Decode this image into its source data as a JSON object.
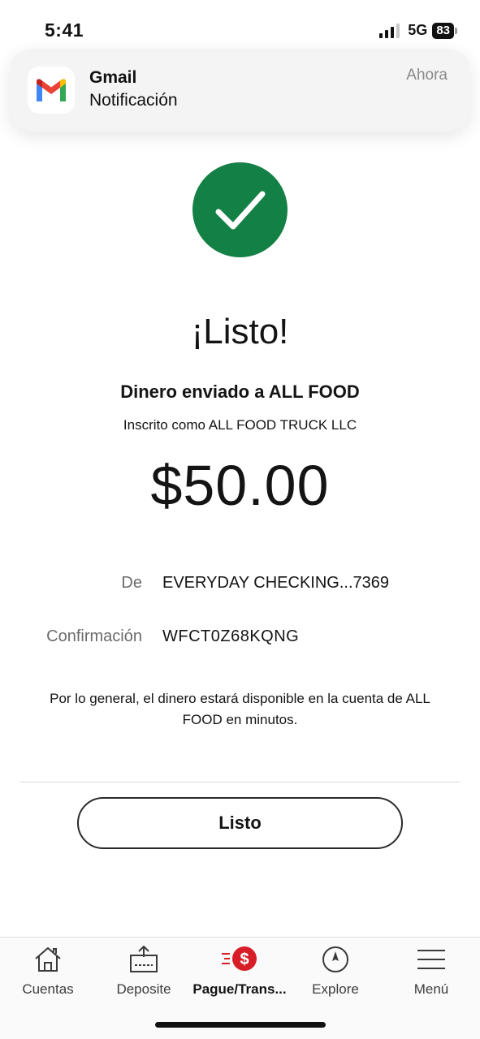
{
  "status_bar": {
    "time": "5:41",
    "network": "5G",
    "battery": "83"
  },
  "notification": {
    "app": "Gmail",
    "body": "Notificación",
    "time": "Ahora",
    "icon": "gmail-icon"
  },
  "confirmation": {
    "icon": "checkmark-icon",
    "accent_color": "#138046",
    "title": "¡Listo!",
    "sent_to": "Dinero enviado a ALL FOOD",
    "registered_as": "Inscrito como ALL FOOD TRUCK LLC",
    "amount": "$50.00",
    "details": {
      "from_label": "De",
      "from_value": "EVERYDAY CHECKING...7369",
      "confirmation_label": "Confirmación",
      "confirmation_value": "WFCT0Z68KQNG"
    },
    "note": "Por lo general, el dinero estará disponible en la cuenta de ALL FOOD en minutos.",
    "done_button": "Listo"
  },
  "bottom_nav": {
    "items": [
      {
        "label": "Cuentas",
        "icon": "house-icon"
      },
      {
        "label": "Deposite",
        "icon": "deposit-icon"
      },
      {
        "label": "Pague/Trans...",
        "icon": "pay-transfer-icon",
        "active": true
      },
      {
        "label": "Explore",
        "icon": "compass-icon"
      },
      {
        "label": "Menú",
        "icon": "menu-icon"
      }
    ],
    "brand_color": "#d71e28"
  }
}
